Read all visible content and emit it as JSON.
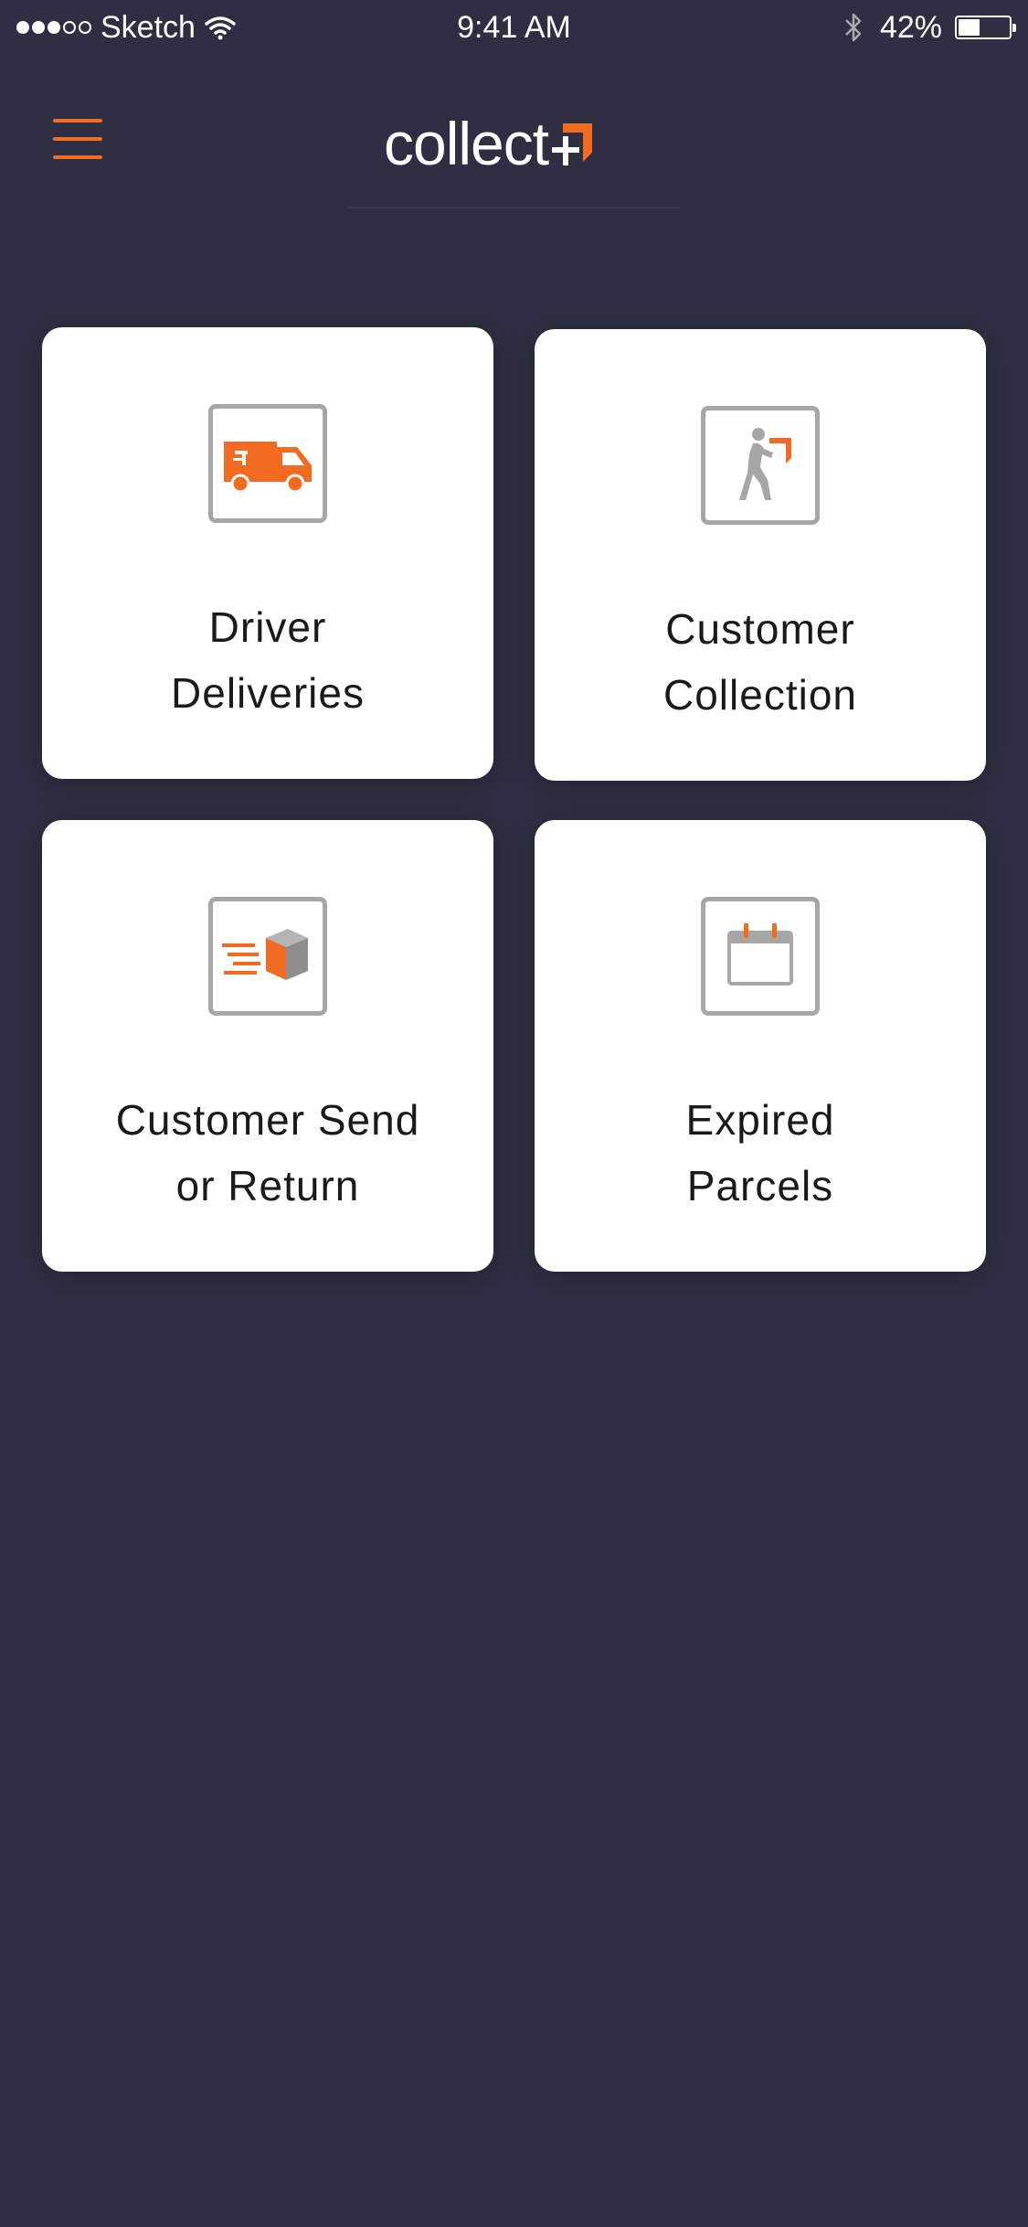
{
  "status_bar": {
    "carrier": "Sketch",
    "time": "9:41 AM",
    "battery_percent": "42%",
    "battery_level": 0.42,
    "signal_bars_filled": 3,
    "signal_bars_total": 5,
    "icons": [
      "wifi-icon",
      "bluetooth-icon",
      "battery-icon"
    ]
  },
  "header": {
    "logo_text": "collect",
    "logo_mark": "+",
    "menu_icon": "hamburger-menu-icon"
  },
  "colors": {
    "background": "#2e2f42",
    "accent": "#f26b21",
    "tile_background": "#ffffff",
    "icon_frame": "#a6a6a6",
    "label_text": "#1a1a1a"
  },
  "tiles": [
    {
      "line1": "Driver",
      "line2": "Deliveries",
      "icon": "delivery-van-icon"
    },
    {
      "line1": "Customer",
      "line2": "Collection",
      "icon": "person-carrying-parcel-icon"
    },
    {
      "line1": "Customer Send",
      "line2": "or Return",
      "icon": "speeding-parcel-icon"
    },
    {
      "line1": "Expired",
      "line2": "Parcels",
      "icon": "calendar-icon"
    }
  ]
}
